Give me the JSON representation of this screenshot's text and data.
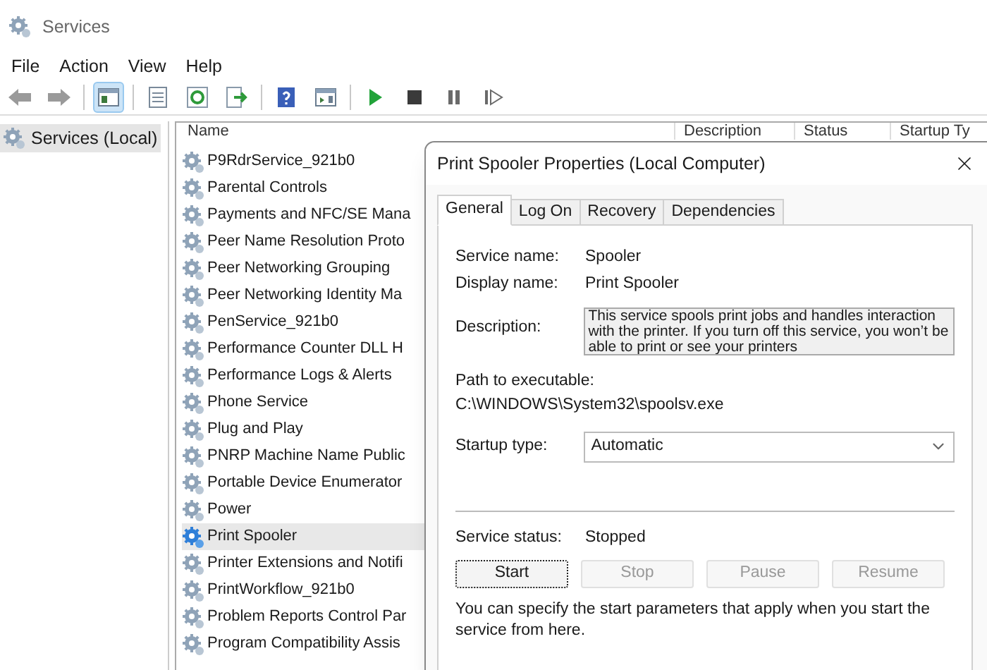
{
  "window": {
    "title": "Services"
  },
  "menu": [
    "File",
    "Action",
    "View",
    "Help"
  ],
  "toolbar": [
    [
      {
        "kind": "back",
        "selected": false
      },
      {
        "kind": "forward",
        "selected": false
      }
    ],
    [
      {
        "kind": "tree",
        "selected": true
      }
    ],
    [
      {
        "kind": "properties",
        "selected": false
      },
      {
        "kind": "refresh",
        "selected": false
      },
      {
        "kind": "export",
        "selected": false
      }
    ],
    [
      {
        "kind": "help",
        "selected": false
      },
      {
        "kind": "view",
        "selected": false
      }
    ],
    [
      {
        "kind": "play",
        "selected": false
      },
      {
        "kind": "stop",
        "selected": false
      },
      {
        "kind": "pause",
        "selected": false
      },
      {
        "kind": "resume",
        "selected": false
      }
    ]
  ],
  "tree": {
    "items": [
      {
        "label": "Services (Local)",
        "selected": true
      }
    ]
  },
  "list": {
    "columns": [
      "Name",
      "Description",
      "Status",
      "Startup Ty"
    ],
    "rows": [
      {
        "name": "P9RdrService_921b0",
        "selected": false
      },
      {
        "name": "Parental Controls",
        "selected": false
      },
      {
        "name": "Payments and NFC/SE Mana",
        "selected": false
      },
      {
        "name": "Peer Name Resolution Proto",
        "selected": false
      },
      {
        "name": "Peer Networking Grouping",
        "selected": false
      },
      {
        "name": "Peer Networking Identity Ma",
        "selected": false
      },
      {
        "name": "PenService_921b0",
        "selected": false
      },
      {
        "name": "Performance Counter DLL H",
        "selected": false
      },
      {
        "name": "Performance Logs & Alerts",
        "selected": false
      },
      {
        "name": "Phone Service",
        "selected": false
      },
      {
        "name": "Plug and Play",
        "selected": false
      },
      {
        "name": "PNRP Machine Name Public",
        "selected": false
      },
      {
        "name": "Portable Device Enumerator",
        "selected": false
      },
      {
        "name": "Power",
        "selected": false
      },
      {
        "name": "Print Spooler",
        "selected": true
      },
      {
        "name": "Printer Extensions and Notifi",
        "selected": false
      },
      {
        "name": "PrintWorkflow_921b0",
        "selected": false
      },
      {
        "name": "Problem Reports Control Par",
        "selected": false
      },
      {
        "name": "Program Compatibility Assis",
        "selected": false
      }
    ]
  },
  "dialog": {
    "title": "Print Spooler Properties (Local Computer)",
    "tabs": [
      {
        "label": "General",
        "selected": true
      },
      {
        "label": "Log On",
        "selected": false
      },
      {
        "label": "Recovery",
        "selected": false
      },
      {
        "label": "Dependencies",
        "selected": false
      }
    ],
    "fields": [
      {
        "label": "Service name:",
        "value": "Spooler"
      },
      {
        "label": "Display name:",
        "value": "Print Spooler"
      }
    ],
    "description": {
      "label": "Description:",
      "value": "This service spools print jobs and handles interaction with the printer.  If you turn off this service, you won’t be able to print or see your printers"
    },
    "path": {
      "label": "Path to executable:",
      "value": "C:\\WINDOWS\\System32\\spoolsv.exe"
    },
    "startup": {
      "label": "Startup type:",
      "value": "Automatic"
    },
    "status": {
      "label": "Service status:",
      "value": "Stopped"
    },
    "buttons": [
      {
        "label": "Start",
        "disabled": false
      },
      {
        "label": "Stop",
        "disabled": true
      },
      {
        "label": "Pause",
        "disabled": true
      },
      {
        "label": "Resume",
        "disabled": true
      }
    ],
    "note": "You can specify the start parameters that apply when you start the service from here."
  }
}
